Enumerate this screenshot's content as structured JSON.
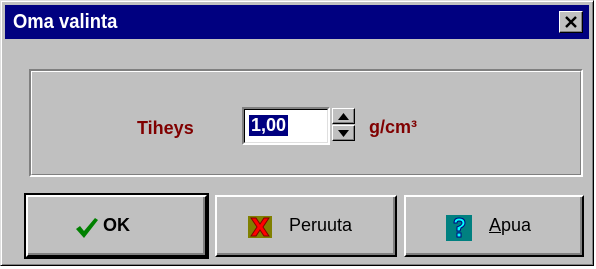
{
  "window": {
    "title": "Oma valinta",
    "close_icon": "close-x-icon"
  },
  "density": {
    "label": "Tiheys",
    "value": "1,00",
    "unit": "g/cm³"
  },
  "buttons": {
    "ok": {
      "label": "OK",
      "icon": "checkmark-icon"
    },
    "cancel": {
      "label": "Peruuta",
      "icon": "red-x-icon"
    },
    "help": {
      "label": "Apua",
      "icon": "question-mark-icon"
    }
  },
  "colors": {
    "titlebar": "#000080",
    "face": "#c0c0c0",
    "label_text": "#800000",
    "check_green": "#008000",
    "cancel_red": "#ff0000",
    "help_cyan": "#00ffff",
    "help_bg": "#008080"
  }
}
